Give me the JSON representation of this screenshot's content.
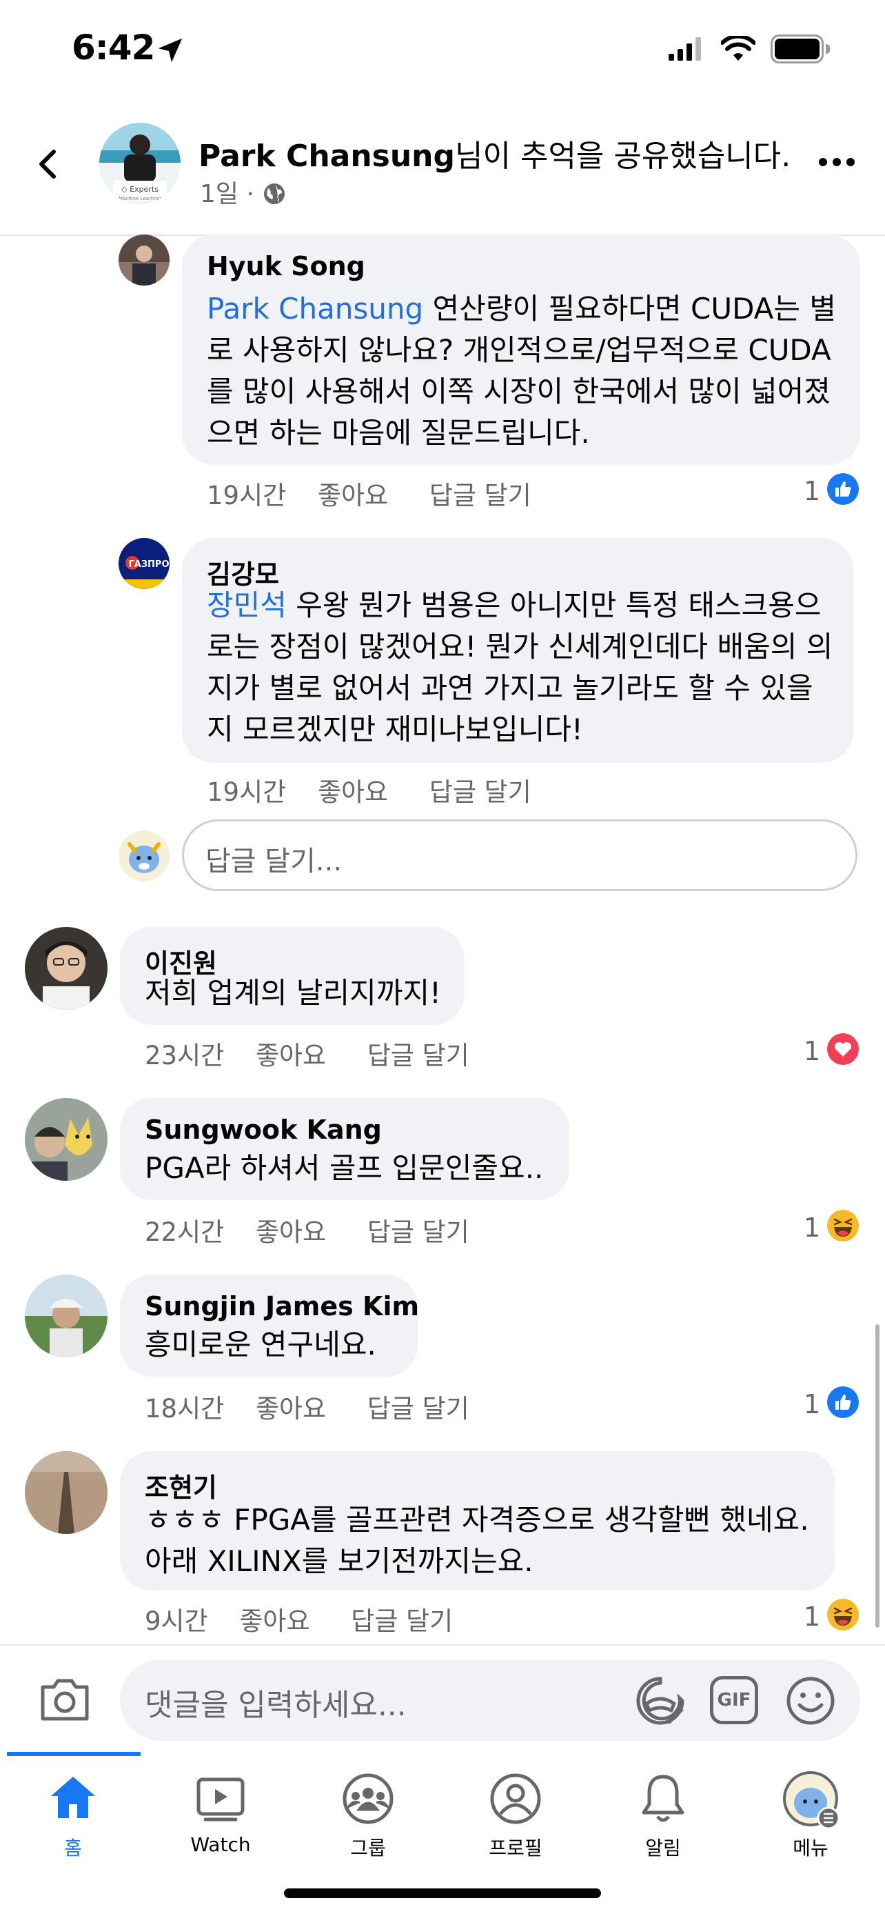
{
  "status_bar": {
    "time": "6:42"
  },
  "header": {
    "author": "Park Chansung",
    "action_text": "님이 추억을 공유했습니다.",
    "time": "1일",
    "dot": "·"
  },
  "comments": [
    {
      "name": "Hyuk Song",
      "mention": "Park Chansung",
      "text_lines": [
        " 연산량이 필요하다면 CUDA는 별",
        "로 사용하지 않나요? 개인적으로/업무적으로 CUDA",
        "를 많이 사용해서 이쪽 시장이 한국에서 많이 넓어졌",
        "으면 하는 마음에 질문드립니다."
      ],
      "time": "19시간",
      "like_label": "좋아요",
      "reply_label": "답글 달기",
      "reaction_count": "1",
      "reaction": "like-icon"
    },
    {
      "name": "김강모",
      "avatar_text": "ГАЗПРО",
      "mention": "장민석",
      "text_lines": [
        " 우왕 뭔가 범용은 아니지만 특정 태스크용으",
        "로는 장점이 많겠어요! 뭔가 신세계인데다 배움의 의",
        "지가 별로 없어서 과연 가지고 놀기라도 할 수 있을",
        "지 모르겠지만 재미나보입니다!"
      ],
      "time": "19시간",
      "like_label": "좋아요",
      "reply_label": "답글 달기"
    },
    {
      "name": "이진원",
      "text_lines": [
        "저희 업계의 날리지까지!"
      ],
      "time": "23시간",
      "like_label": "좋아요",
      "reply_label": "답글 달기",
      "reaction_count": "1",
      "reaction": "heart-icon"
    },
    {
      "name": "Sungwook Kang",
      "text_lines": [
        "PGA라 하셔서 골프 입문인줄요.."
      ],
      "time": "22시간",
      "like_label": "좋아요",
      "reply_label": "답글 달기",
      "reaction_count": "1",
      "reaction": "haha-icon"
    },
    {
      "name": "Sungjin James Kim",
      "text_lines": [
        "흥미로운 연구네요."
      ],
      "time": "18시간",
      "like_label": "좋아요",
      "reply_label": "답글 달기",
      "reaction_count": "1",
      "reaction": "like-icon"
    },
    {
      "name": "조현기",
      "text_lines": [
        "ㅎㅎㅎ FPGA를 골프관련 자격증으로 생각할뻔 했네요.",
        "아래 XILINX를 보기전까지는요."
      ],
      "time": "9시간",
      "like_label": "좋아요",
      "reply_label": "답글 달기",
      "reaction_count": "1",
      "reaction": "haha-icon"
    }
  ],
  "reply_input": {
    "placeholder": "답글 달기..."
  },
  "composer": {
    "placeholder": "댓글을 입력하세요...",
    "gif_label": "GIF"
  },
  "tabs": [
    {
      "label": "홈",
      "icon": "home-icon",
      "active": true
    },
    {
      "label": "Watch",
      "icon": "watch-icon"
    },
    {
      "label": "그룹",
      "icon": "groups-icon"
    },
    {
      "label": "프로필",
      "icon": "profile-icon"
    },
    {
      "label": "알림",
      "icon": "bell-icon"
    },
    {
      "label": "메뉴",
      "icon": "menu-icon"
    }
  ],
  "colors": {
    "accent": "#1877f2",
    "mention": "#216fdb",
    "bubble": "#f0f2f5",
    "meta": "#65676b",
    "heart": "#f33e58",
    "haha": "#f7b928"
  }
}
